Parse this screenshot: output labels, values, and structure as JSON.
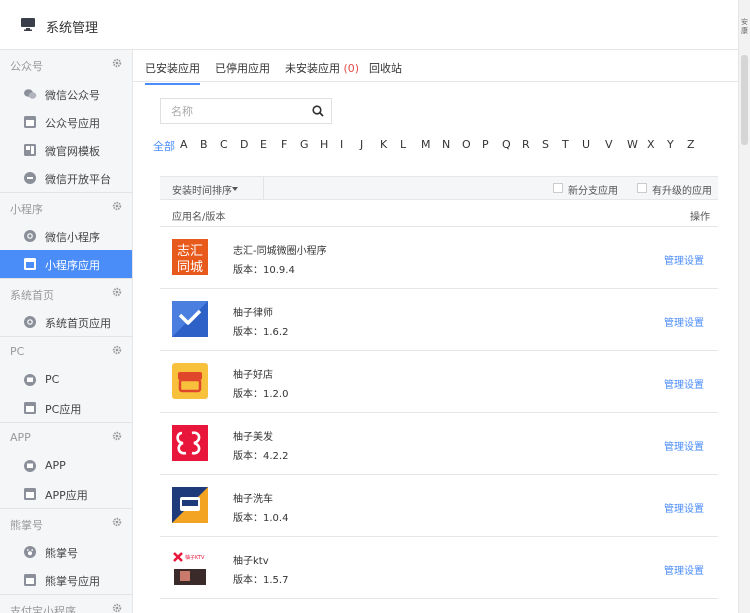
{
  "header": {
    "title": "系统管理",
    "corner_text": "安康"
  },
  "sidebar": {
    "sections": [
      {
        "label": "公众号",
        "items": [
          {
            "label": "微信公众号"
          },
          {
            "label": "公众号应用"
          },
          {
            "label": "微官网模板"
          },
          {
            "label": "微信开放平台"
          }
        ]
      },
      {
        "label": "小程序",
        "items": [
          {
            "label": "微信小程序"
          },
          {
            "label": "小程序应用",
            "active": true
          }
        ]
      },
      {
        "label": "系统首页",
        "items": [
          {
            "label": "系统首页应用"
          }
        ]
      },
      {
        "label": "PC",
        "items": [
          {
            "label": "PC"
          },
          {
            "label": "PC应用"
          }
        ]
      },
      {
        "label": "APP",
        "items": [
          {
            "label": "APP"
          },
          {
            "label": "APP应用"
          }
        ]
      },
      {
        "label": "熊掌号",
        "items": [
          {
            "label": "熊掌号"
          },
          {
            "label": "熊掌号应用"
          }
        ]
      },
      {
        "label": "支付宝小程序",
        "items": []
      }
    ]
  },
  "tabs": [
    {
      "label": "已安装应用"
    },
    {
      "label": "已停用应用"
    },
    {
      "label": "未安装应用",
      "count": "(0)"
    },
    {
      "label": "回收站"
    }
  ],
  "search": {
    "placeholder": "名称"
  },
  "letters": [
    "全部",
    "A",
    "B",
    "C",
    "D",
    "E",
    "F",
    "G",
    "H",
    "I",
    "J",
    "K",
    "L",
    "M",
    "N",
    "O",
    "P",
    "Q",
    "R",
    "S",
    "T",
    "U",
    "V",
    "W",
    "X",
    "Y",
    "Z"
  ],
  "filter": {
    "sort_label": "安装时间排序",
    "branch_label": "新分支应用",
    "upgrade_label": "有升级的应用"
  },
  "table": {
    "col_name": "应用名/版本",
    "col_action": "操作",
    "rows": [
      {
        "name": "志汇-同城微圈小程序",
        "version": "版本：10.9.4",
        "action": "管理设置",
        "logo_text": "志汇 同城"
      },
      {
        "name": "柚子律师",
        "version": "版本：1.6.2",
        "action": "管理设置"
      },
      {
        "name": "柚子好店",
        "version": "版本：1.2.0",
        "action": "管理设置"
      },
      {
        "name": "柚子美发",
        "version": "版本：4.2.2",
        "action": "管理设置"
      },
      {
        "name": "柚子洗车",
        "version": "版本：1.0.4",
        "action": "管理设置"
      },
      {
        "name": "柚子ktv",
        "version": "版本：1.5.7",
        "action": "管理设置",
        "logo_text": "柚子KTV"
      }
    ]
  },
  "colors": {
    "accent": "#4b8df8",
    "count_red": "#e34c4c",
    "sidebar_bg": "#f5f6f8"
  }
}
